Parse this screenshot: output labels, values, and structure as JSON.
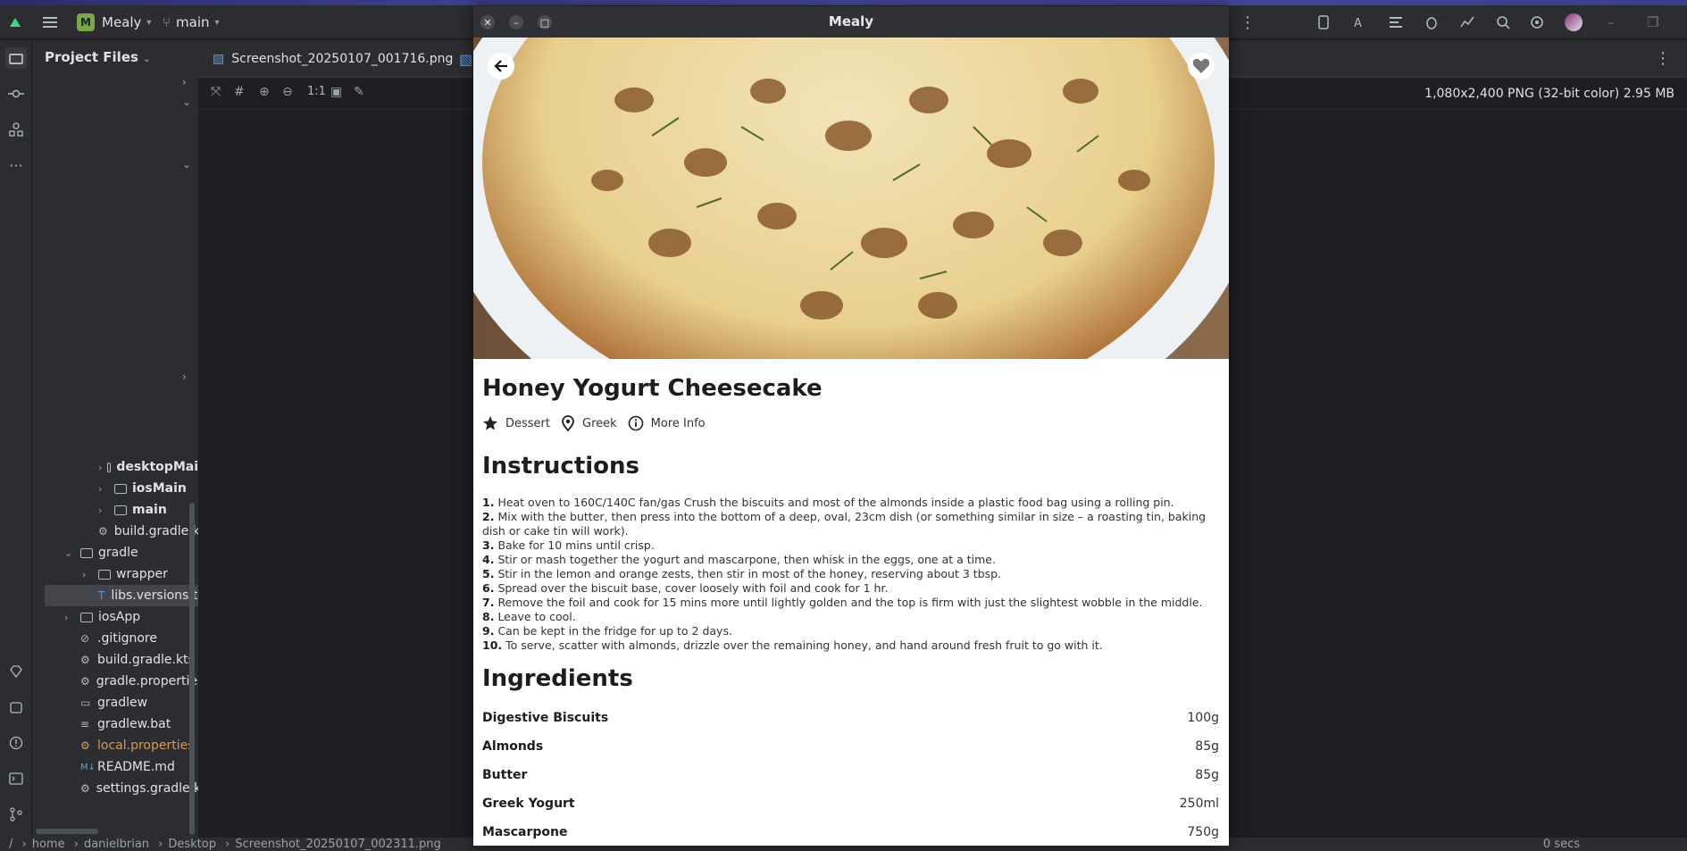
{
  "ide": {
    "project_name": "Mealy",
    "project_badge": "M",
    "branch": "main",
    "panel_title": "Project Files",
    "tab_file": "Screenshot_20250107_001716.png",
    "image_info": "1,080x2,400 PNG (32-bit color) 2.95 MB",
    "zoom_label": "1:1",
    "tree": [
      {
        "label": "desktopMai",
        "type": "folder",
        "chevron": "›"
      },
      {
        "label": "iosMain",
        "type": "folder",
        "chevron": "›"
      },
      {
        "label": "main",
        "type": "folder",
        "chevron": "›"
      },
      {
        "label": "build.gradle.kts",
        "type": "file"
      },
      {
        "label": "gradle",
        "type": "folder",
        "chevron": "⌄"
      },
      {
        "label": "wrapper",
        "type": "folder",
        "chevron": "›"
      },
      {
        "label": "libs.versions.to",
        "type": "file",
        "selected": true
      },
      {
        "label": "iosApp",
        "type": "folder",
        "chevron": "›"
      },
      {
        "label": ".gitignore",
        "type": "file"
      },
      {
        "label": "build.gradle.kts",
        "type": "file"
      },
      {
        "label": "gradle.properties",
        "type": "file"
      },
      {
        "label": "gradlew",
        "type": "file"
      },
      {
        "label": "gradlew.bat",
        "type": "file"
      },
      {
        "label": "local.properties",
        "type": "file",
        "color": "#d69a5c"
      },
      {
        "label": "README.md",
        "type": "file"
      },
      {
        "label": "settings.gradle.kt",
        "type": "file"
      }
    ],
    "status": {
      "path": [
        "/",
        "home",
        "danielbrian",
        "Desktop",
        "Screenshot_20250107_002311.png"
      ],
      "timer": "0 secs"
    }
  },
  "app": {
    "window_title": "Mealy",
    "recipe_title": "Honey Yogurt Cheesecake",
    "meta": [
      {
        "icon": "star-icon",
        "label": "Dessert"
      },
      {
        "icon": "location-pin-icon",
        "label": "Greek"
      },
      {
        "icon": "info-icon",
        "label": "More Info"
      }
    ],
    "instructions_heading": "Instructions",
    "instructions": [
      {
        "num": "1.",
        "text": "Heat oven to 160C/140C fan/gas Crush the biscuits and most of the almonds inside a plastic food bag using a rolling pin."
      },
      {
        "num": "2.",
        "text": "Mix with the butter, then press into the bottom of a deep, oval, 23cm dish (or something similar in size – a roasting tin, baking dish or cake tin will work)."
      },
      {
        "num": "3.",
        "text": "Bake for 10 mins until crisp."
      },
      {
        "num": "4.",
        "text": "Stir or mash together the yogurt and mascarpone, then whisk in the eggs, one at a time."
      },
      {
        "num": "5.",
        "text": "Stir in the lemon and orange zests, then stir in most of the honey, reserving about 3 tbsp."
      },
      {
        "num": "6.",
        "text": "Spread over the biscuit base, cover loosely with foil and cook for 1 hr."
      },
      {
        "num": "7.",
        "text": "Remove the foil and cook for 15 mins more until lightly golden and the top is firm with just the slightest wobble in the middle."
      },
      {
        "num": "8.",
        "text": "Leave to cool."
      },
      {
        "num": "9.",
        "text": "Can be kept in the fridge for up to 2 days."
      },
      {
        "num": "10.",
        "text": "To serve, scatter with almonds, drizzle over the remaining honey, and hand around fresh fruit to go with it."
      }
    ],
    "ingredients_heading": "Ingredients",
    "ingredients": [
      {
        "name": "Digestive Biscuits",
        "qty": "100g"
      },
      {
        "name": "Almonds",
        "qty": "85g"
      },
      {
        "name": "Butter",
        "qty": "85g"
      },
      {
        "name": "Greek Yogurt",
        "qty": "250ml"
      },
      {
        "name": "Mascarpone",
        "qty": "750g"
      }
    ]
  }
}
